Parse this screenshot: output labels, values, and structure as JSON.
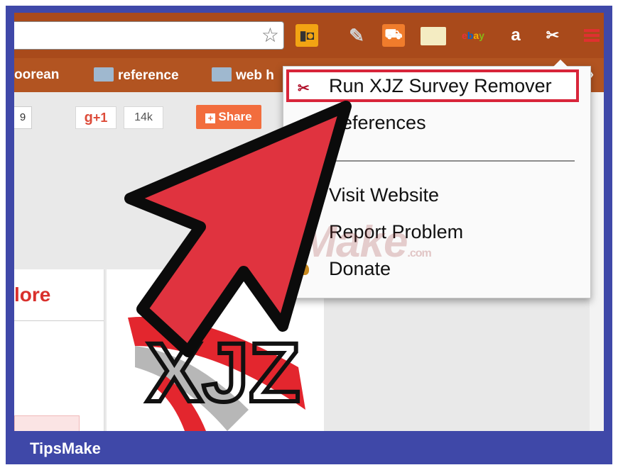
{
  "toolbar": {
    "extensions": [
      "phone-icon",
      "pencil-icon",
      "cart-icon",
      "note-icon",
      "ebay-icon",
      "amazon-icon",
      "xjz-icon",
      "menu-icon"
    ],
    "ebay_label": [
      "e",
      "b",
      "a",
      "y"
    ],
    "amazon_label": "a"
  },
  "bookmarks": {
    "items": [
      "oorean",
      "reference",
      "web h"
    ],
    "overflow": "»"
  },
  "social": {
    "count_left": "9",
    "gplus_label": "+1",
    "gplus_count": "14k",
    "share_label": "Share"
  },
  "page": {
    "more_text": "lore"
  },
  "menu": {
    "run_label": "Run XJZ Survey Remover",
    "prefs_label": "eferences",
    "visit_label": "Visit Website",
    "report_label": "Report Problem",
    "donate_label": "Donate"
  },
  "overlay": {
    "logo_text": "XJZ",
    "watermark": "TipsMake",
    "watermark_suffix": ".com"
  },
  "footer": {
    "brand": "TipsMake"
  },
  "colors": {
    "frame": "#3f48a8",
    "toolbar": "#a94a1b",
    "highlight": "#d8253a",
    "arrow_fill": "#e0333f"
  }
}
